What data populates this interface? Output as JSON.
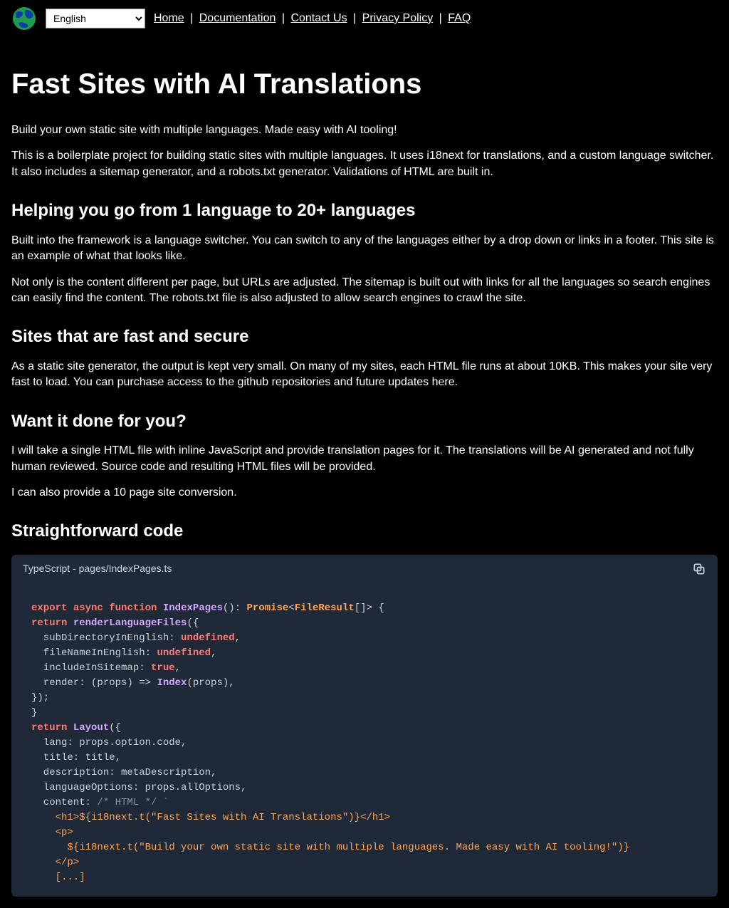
{
  "lang_selected": "English",
  "nav": {
    "home": "Home",
    "documentation": "Documentation",
    "contact": "Contact Us",
    "privacy": "Privacy Policy",
    "faq": "FAQ",
    "sep": "|"
  },
  "h1": "Fast Sites with AI Translations",
  "p1": "Build your own static site with multiple languages. Made easy with AI tooling!",
  "p2": "This is a boilerplate project for building static sites with multiple languages. It uses i18next for translations, and a custom language switcher. It also includes a sitemap generator, and a robots.txt generator. Validations of HTML are built in.",
  "h2a": "Helping you go from 1 language to 20+ languages",
  "p3": "Built into the framework is a language switcher. You can switch to any of the languages either by a drop down or links in a footer. This site is an example of what that looks like.",
  "p4": "Not only is the content different per page, but URLs are adjusted. The sitemap is built out with links for all the languages so search engines can easily find the content. The robots.txt file is also adjusted to allow search engines to crawl the site.",
  "h2b": "Sites that are fast and secure",
  "p5": "As a static site generator, the output is kept very small. On many of my sites, each HTML file runs at about 10KB. This makes your site very fast to load. You can purchase access to the github repositories and future updates here.",
  "h2c": "Want it done for you?",
  "p6": "I will take a single HTML file with inline JavaScript and provide translation pages for it. The translations will be AI generated and not fully human reviewed. Source code and resulting HTML files will be provided.",
  "p7": "I can also provide a 10 page site conversion.",
  "h2d": "Straightforward code",
  "code_title": "TypeScript - pages/IndexPages.ts",
  "code": {
    "l1a": "export",
    "l1b": "async",
    "l1c": "function",
    "l1d": "IndexPages",
    "l1e": "(): ",
    "l1f": "Promise",
    "l1g": "<",
    "l1h": "FileResult",
    "l1i": "[]> {",
    "l2a": "return",
    "l2b": "renderLanguageFiles",
    "l2c": "({",
    "l3a": "  subDirectoryInEnglish: ",
    "l3b": "undefined",
    "l3c": ",",
    "l4a": "  fileNameInEnglish: ",
    "l4b": "undefined",
    "l4c": ",",
    "l5a": "  includeInSitemap: ",
    "l5b": "true",
    "l5c": ",",
    "l6a": "  render: (props) => ",
    "l6b": "Index",
    "l6c": "(props),",
    "l7": "});",
    "l8": "}",
    "l9a": "return",
    "l9b": "Layout",
    "l9c": "({",
    "l10": "  lang: props.option.code,",
    "l11": "  title: title,",
    "l12": "  description: metaDescription,",
    "l13": "  languageOptions: props.allOptions,",
    "l14a": "  content: ",
    "l14b": "/* HTML */",
    "l14c": " `",
    "l15": "    <h1>${i18next.t(\"Fast Sites with AI Translations\")}</h1>",
    "l16": "    <p>",
    "l17": "      ${i18next.t(\"Build your own static site with multiple languages. Made easy with AI tooling!\")}",
    "l18": "    </p>",
    "l19": "    [...]"
  }
}
